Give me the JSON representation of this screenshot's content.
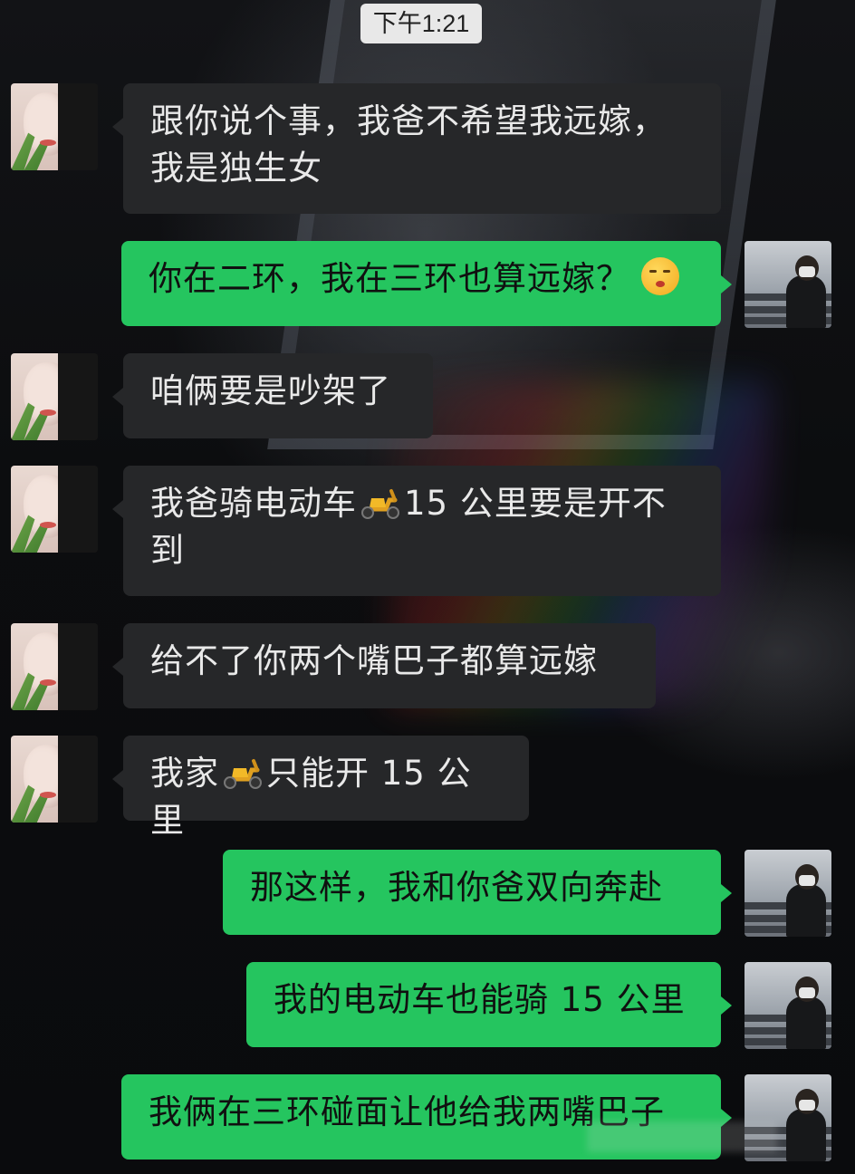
{
  "chat": {
    "timestamp": "下午1:21",
    "messages": [
      {
        "side": "left",
        "text_lines": [
          "跟你说个事，我爸不希望我远嫁，",
          "我是独生女"
        ]
      },
      {
        "side": "right",
        "text": "你在二环，我在三环也算远嫁？",
        "emoji": "shushing-face-emoji"
      },
      {
        "side": "left",
        "text": "咱俩要是吵架了"
      },
      {
        "side": "left",
        "text_before": "我爸骑电动车",
        "emoji": "scooter-emoji",
        "text_after": "15 公里要是开不",
        "text_line2": "到"
      },
      {
        "side": "left",
        "text": "给不了你两个嘴巴子都算远嫁"
      },
      {
        "side": "left",
        "text_before": "我家",
        "emoji": "scooter-emoji",
        "text_after": "只能开 15 公里"
      },
      {
        "side": "right",
        "text": "那这样，我和你爸双向奔赴"
      },
      {
        "side": "right",
        "text": "我的电动车也能骑 15 公里"
      },
      {
        "side": "right",
        "text": "我俩在三环碰面让他给我两嘴巴子"
      }
    ]
  },
  "colors": {
    "sent_bubble": "#25c55f",
    "received_bubble": "#262729",
    "background": "#0d0e10"
  }
}
